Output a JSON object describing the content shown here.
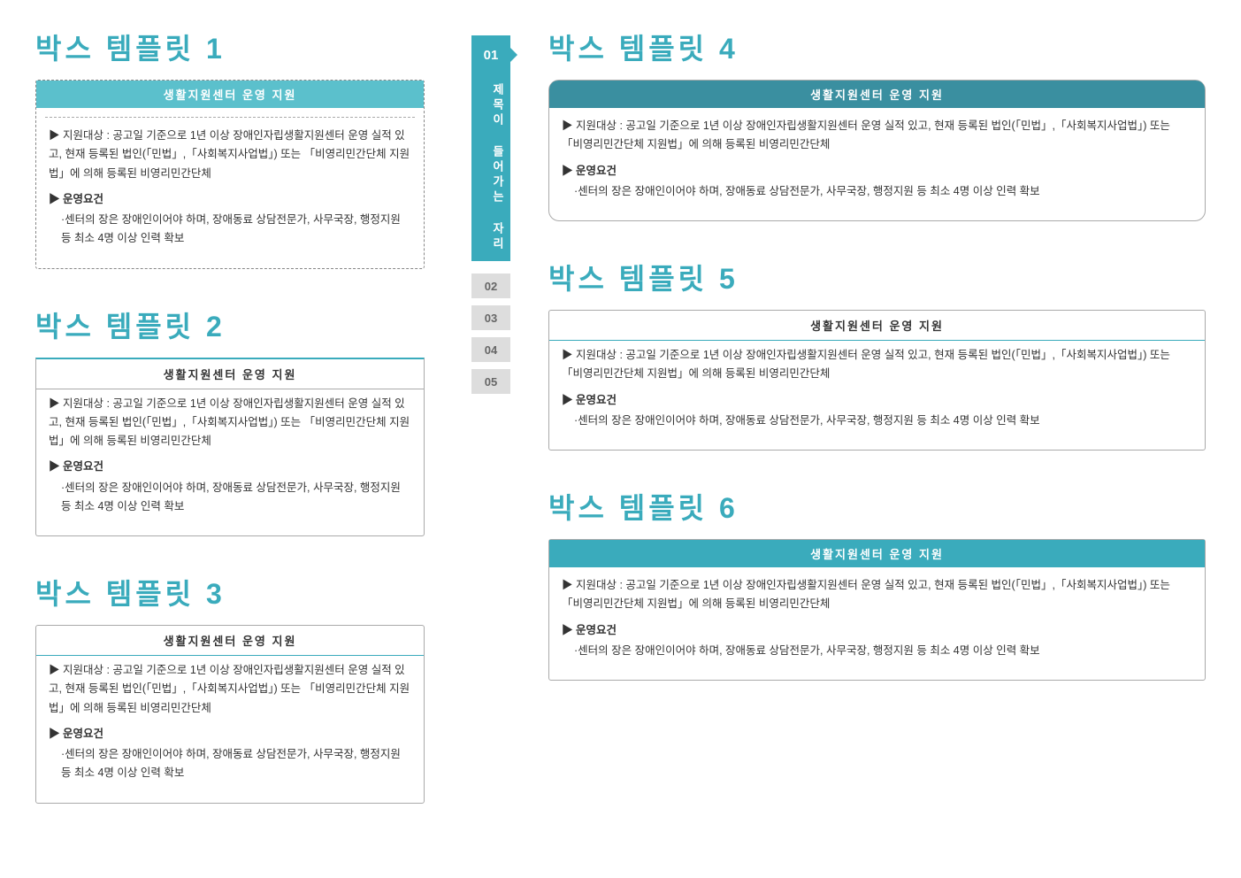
{
  "templates": [
    {
      "id": "template1",
      "title": "박스  템플릿  1",
      "header": "생활지원센터 운영  지원",
      "support_label": "▶ 지원대상 :",
      "support_text": "공고일 기준으로 1년 이상 장애인자립생활지원센터 운영 실적 있고, 현재 등록된 법인(「민법」,「사회복지사업법」) 또는 「비영리민간단체 지원법」에 의해 등록된 비영리민간단체",
      "condition_label": "▶ 운영요건",
      "condition_text": "·센터의 장은 장애인이어야 하며, 장애동료 상담전문가, 사무국장, 행정지원 등 최소 4명 이상 인력 확보"
    },
    {
      "id": "template2",
      "title": "박스  템플릿  2",
      "header": "생활지원센터 운영  지원",
      "support_label": "▶ 지원대상 :",
      "support_text": "공고일 기준으로 1년 이상 장애인자립생활지원센터 운영 실적 있고, 현재 등록된 법인(「민법」,「사회복지사업법」) 또는 「비영리민간단체 지원법」에 의해 등록된 비영리민간단체",
      "condition_label": "▶ 운영요건",
      "condition_text": "·센터의 장은 장애인이어야 하며, 장애동료 상담전문가, 사무국장, 행정지원 등 최소 4명 이상 인력 확보"
    },
    {
      "id": "template3",
      "title": "박스  템플릿  3",
      "header": "생활지원센터 운영  지원",
      "support_label": "▶ 지원대상 :",
      "support_text": "공고일 기준으로 1년 이상 장애인자립생활지원센터 운영 실적 있고, 현재 등록된 법인(「민법」,「사회복지사업법」) 또는 「비영리민간단체 지원법」에 의해 등록된 비영리민간단체",
      "condition_label": "▶ 운영요건",
      "condition_text": "·센터의 장은 장애인이어야 하며, 장애동료 상담전문가, 사무국장, 행정지원 등 최소 4명 이상 인력 확보"
    },
    {
      "id": "template4",
      "title": "박스  템플릿  4",
      "header": "생활지원센터 운영  지원",
      "support_label": "▶ 지원대상 :",
      "support_text": "공고일 기준으로 1년 이상 장애인자립생활지원센터 운영 실적 있고, 현재 등록된 법인(「민법」,「사회복지사업법」) 또는 「비영리민간단체 지원법」에 의해 등록된 비영리민간단체",
      "condition_label": "▶ 운영요건",
      "condition_text": "·센터의 장은 장애인이어야 하며, 장애동료 상담전문가, 사무국장, 행정지원 등 최소 4명 이상 인력 확보"
    },
    {
      "id": "template5",
      "title": "박스  템플릿  5",
      "header": "생활지원센터 운영  지원",
      "support_label": "▶ 지원대상 :",
      "support_text": "공고일 기준으로 1년 이상 장애인자립생활지원센터 운영 실적 있고, 현재 등록된 법인(「민법」,「사회복지사업법」) 또는 「비영리민간단체 지원법」에 의해 등록된 비영리민간단체",
      "condition_label": "▶ 운영요건",
      "condition_text": "·센터의 장은 장애인이어야 하며, 장애동료 상담전문가, 사무국장, 행정지원 등 최소 4명 이상 인력 확보"
    },
    {
      "id": "template6",
      "title": "박스  템플릿  6",
      "header": "생활지원센터 운영  지원",
      "support_label": "▶ 지원대상 :",
      "support_text": "공고일 기준으로 1년 이상 장애인자립생활지원센터 운영 실적 있고, 현재 등록된 법인(「민법」,「사회복지사업법」) 또는 「비영리민간단체 지원법」에 의해 등록된 비영리민간단체",
      "condition_label": "▶ 운영요건",
      "condition_text": "·센터의 장은 장애인이어야 하며, 장애동료 상담전문가, 사무국장, 행정지원 등 최소 4명 이상 인력 확보"
    }
  ],
  "center_strip": {
    "number_active": "01",
    "vertical_text": "제목이 들어가는 자리",
    "numbers_inactive": [
      "02",
      "03",
      "04",
      "05"
    ]
  },
  "colors": {
    "primary": "#3aabbc",
    "dark": "#3a8fa0",
    "inactive": "#b0b0b0"
  }
}
